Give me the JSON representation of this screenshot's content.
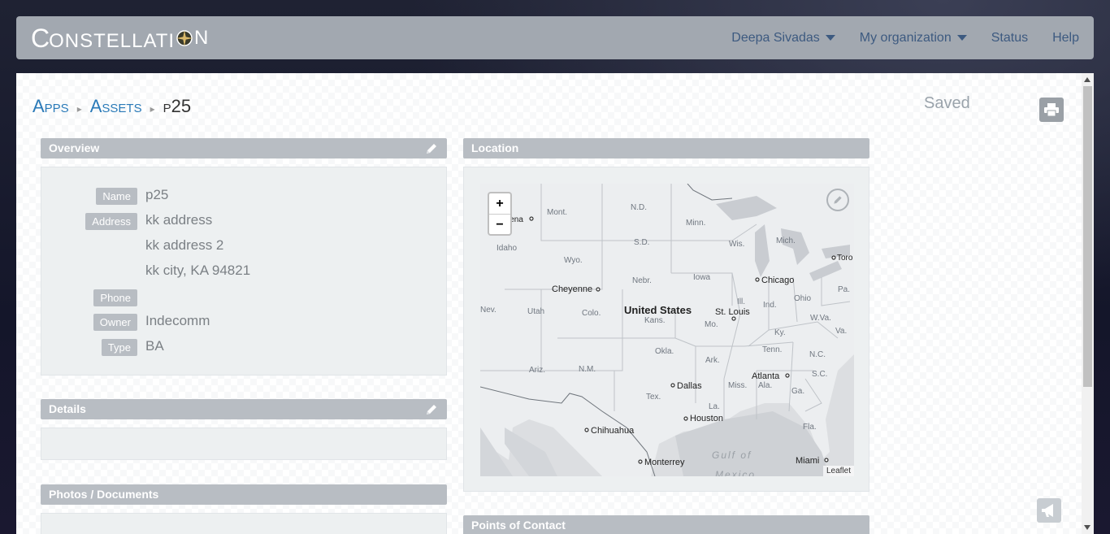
{
  "navbar": {
    "logo_text": "ONSTELLATI",
    "logo_c": "C",
    "logo_n": "N",
    "user": "Deepa Sivadas",
    "org": "My organization",
    "status": "Status",
    "help": "Help"
  },
  "breadcrumb": {
    "apps": "Apps",
    "assets": "Assets",
    "current": "p25",
    "sep": "▸"
  },
  "status_text": "Saved",
  "overview": {
    "title": "Overview",
    "fields": {
      "name_label": "Name",
      "name_value": "p25",
      "address_label": "Address",
      "address_line1": "kk address",
      "address_line2": "kk address 2",
      "address_line3": "kk city, KA  94821",
      "phone_label": "Phone",
      "phone_value": "",
      "owner_label": "Owner",
      "owner_value": "Indecomm",
      "type_label": "Type",
      "type_value": "BA"
    }
  },
  "details": {
    "title": "Details"
  },
  "photos": {
    "title": "Photos / Documents"
  },
  "location": {
    "title": "Location",
    "zoom_in": "+",
    "zoom_out": "−",
    "attribution": "Leaflet",
    "map_labels": {
      "helena": "lena",
      "mont": "Mont.",
      "nd": "N.D.",
      "minn": "Minn.",
      "idaho": "Idaho",
      "wyo": "Wyo.",
      "sd": "S.D.",
      "wis": "Wis.",
      "mich": "Mich.",
      "toronto": "Toro",
      "nebr": "Nebr.",
      "iowa": "Iowa",
      "chicago": "Chicago",
      "cheyenne": "Cheyenne",
      "pa": "Pa.",
      "nev": "Nev.",
      "utah": "Utah",
      "colo": "Colo.",
      "united_states": "United States",
      "kans": "Kans.",
      "stlouis": "St. Louis",
      "ill": "Ill.",
      "ind": "Ind.",
      "ohio": "Ohio",
      "wva": "W.Va.",
      "mo": "Mo.",
      "ky": "Ky.",
      "va": "Va.",
      "okla": "Okla.",
      "tenn": "Tenn.",
      "nc": "N.C.",
      "ariz": "Ariz.",
      "nm": "N.M.",
      "ark": "Ark.",
      "atlanta": "Atlanta",
      "sc": "S.C.",
      "dallas": "Dallas",
      "miss": "Miss.",
      "ala": "Ala.",
      "ga": "Ga.",
      "tex": "Tex.",
      "la": "La.",
      "houston": "Houston",
      "fla": "Fla.",
      "chihuahua": "Chihuahua",
      "gulf": "Gulf of",
      "mexico": "Mexico",
      "monterrey": "Monterrey",
      "miami": "Miami"
    }
  },
  "contacts": {
    "title": "Points of Contact"
  }
}
